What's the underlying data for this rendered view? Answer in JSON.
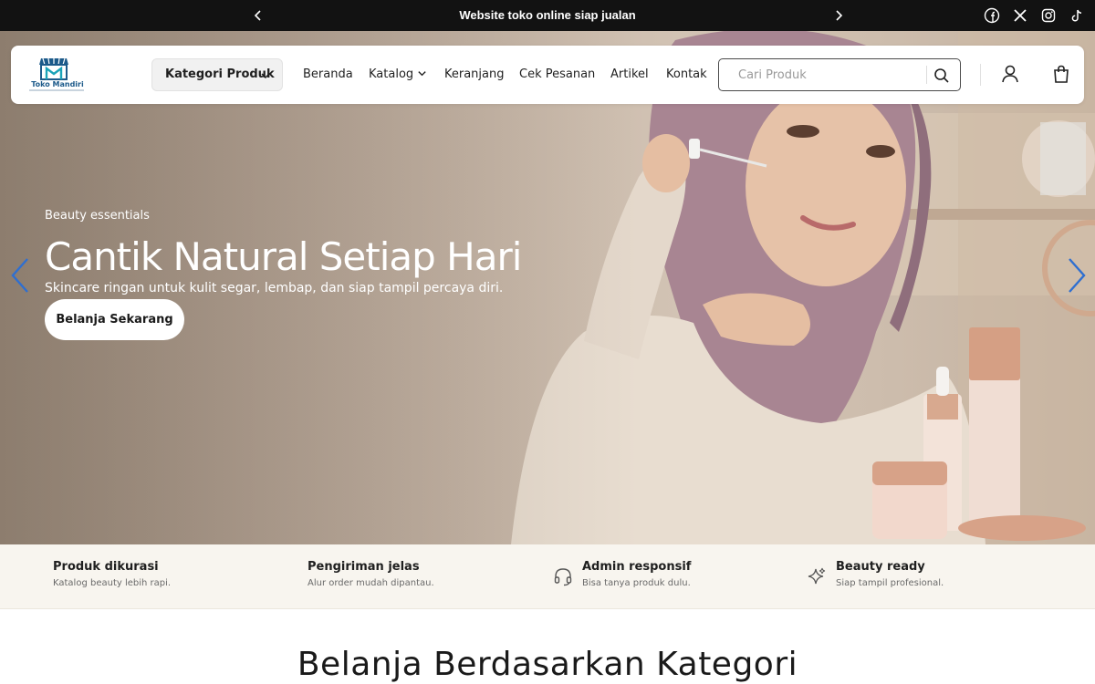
{
  "announcement": {
    "message": "Website toko online siap jualan",
    "prev_icon": "chevron-left-icon",
    "next_icon": "chevron-right-icon",
    "social": [
      "facebook-icon",
      "x-icon",
      "instagram-icon",
      "tiktok-icon"
    ]
  },
  "header": {
    "logo_name": "Toko Mandiri",
    "category_button": "Kategori Produk",
    "nav": {
      "home": "Beranda",
      "catalog": "Katalog",
      "cart": "Keranjang",
      "orders": "Cek Pesanan",
      "articles": "Artikel",
      "contact": "Kontak"
    },
    "search_placeholder": "Cari Produk",
    "icons": [
      "search-icon",
      "user-icon",
      "shopping-bag-icon"
    ]
  },
  "hero": {
    "eyebrow": "Beauty essentials",
    "headline": "Cantik Natural Setiap Hari",
    "subline": "Skincare ringan untuk kulit segar, lembap, dan siap tampil percaya diri.",
    "cta": "Belanja Sekarang"
  },
  "features": [
    {
      "title": "Produk dikurasi",
      "subtitle": "Katalog beauty lebih rapi.",
      "icon": ""
    },
    {
      "title": "Pengiriman jelas",
      "subtitle": "Alur order mudah dipantau.",
      "icon": ""
    },
    {
      "title": "Admin responsif",
      "subtitle": "Bisa tanya produk dulu.",
      "icon": "headset-icon"
    },
    {
      "title": "Beauty ready",
      "subtitle": "Siap tampil profesional.",
      "icon": "sparkle-icon"
    }
  ],
  "section_title": "Belanja Berdasarkan Kategori",
  "colors": {
    "announcement_bg": "#121212",
    "features_bg": "#f8f5ef",
    "slider_arrow": "#2f6fd0",
    "logo_blue": "#1c5a8a"
  }
}
